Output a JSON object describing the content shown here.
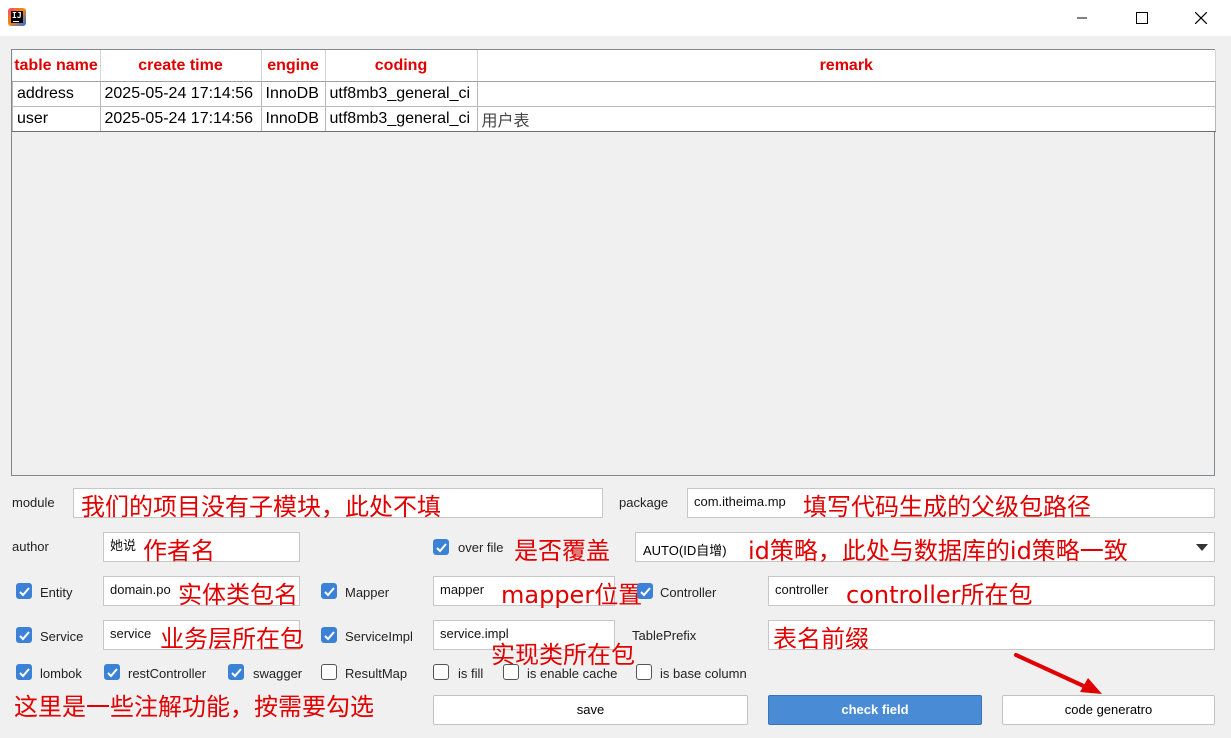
{
  "table": {
    "columns": [
      "table name",
      "create time",
      "engine",
      "coding",
      "remark"
    ],
    "rows": [
      {
        "name": "address",
        "create_time": "2025-05-24 17:14:56",
        "engine": "InnoDB",
        "coding": "utf8mb3_general_ci",
        "remark": ""
      },
      {
        "name": "user",
        "create_time": "2025-05-24 17:14:56",
        "engine": "InnoDB",
        "coding": "utf8mb3_general_ci",
        "remark": "用户表"
      }
    ]
  },
  "form": {
    "module_label": "module",
    "module_value": "",
    "package_label": "package",
    "package_value": "com.itheima.mp",
    "author_label": "author",
    "author_value": "她说",
    "overfile_label": "over file",
    "id_strategy_value": "AUTO(ID自增)",
    "entity_label": "Entity",
    "entity_value": "domain.po",
    "mapper_label": "Mapper",
    "mapper_value": "mapper",
    "controller_label": "Controller",
    "controller_value": "controller",
    "service_label": "Service",
    "service_value": "service",
    "serviceimpl_label": "ServiceImpl",
    "serviceimpl_value": "service.impl",
    "tableprefix_label": "TablePrefix",
    "tableprefix_value": "",
    "lombok_label": "lombok",
    "restcontroller_label": "restController",
    "swagger_label": "swagger",
    "resultmap_label": "ResultMap",
    "isfill_label": "is fill",
    "cache_label": "is enable cache",
    "basecolumn_label": "is base column"
  },
  "checkboxes": {
    "overfile": true,
    "entity": true,
    "mapper": true,
    "controller": true,
    "service": true,
    "serviceimpl": true,
    "lombok": true,
    "restcontroller": true,
    "swagger": true,
    "resultmap": false,
    "isfill": false,
    "cache": false,
    "basecolumn": false
  },
  "buttons": {
    "save": "save",
    "check_field": "check field",
    "code_generator": "code generatro"
  },
  "annotations": {
    "module": "我们的项目没有子模块，此处不填",
    "package": "填写代码生成的父级包路径",
    "author": "作者名",
    "overfile": "是否覆盖",
    "id_strategy": "id策略，此处与数据库的id策略一致",
    "entity": "实体类包名",
    "mapper": "mapper位置",
    "controller": "controller所在包",
    "service": "业务层所在包",
    "serviceimpl": "实现类所在包",
    "tableprefix": "表名前缀",
    "annotations_hint": "这里是一些注解功能，按需要勾选"
  },
  "colors": {
    "annotation": "#e00000",
    "header_text": "#e00000",
    "checkbox_on": "#3b82d6",
    "primary_button": "#4a8bd6"
  },
  "icons": {
    "app": "intellij-idea-icon",
    "minimize": "minimize-icon",
    "maximize": "maximize-icon",
    "close": "close-icon",
    "dropdown": "chevron-down-icon",
    "arrow": "red-arrow-icon"
  }
}
